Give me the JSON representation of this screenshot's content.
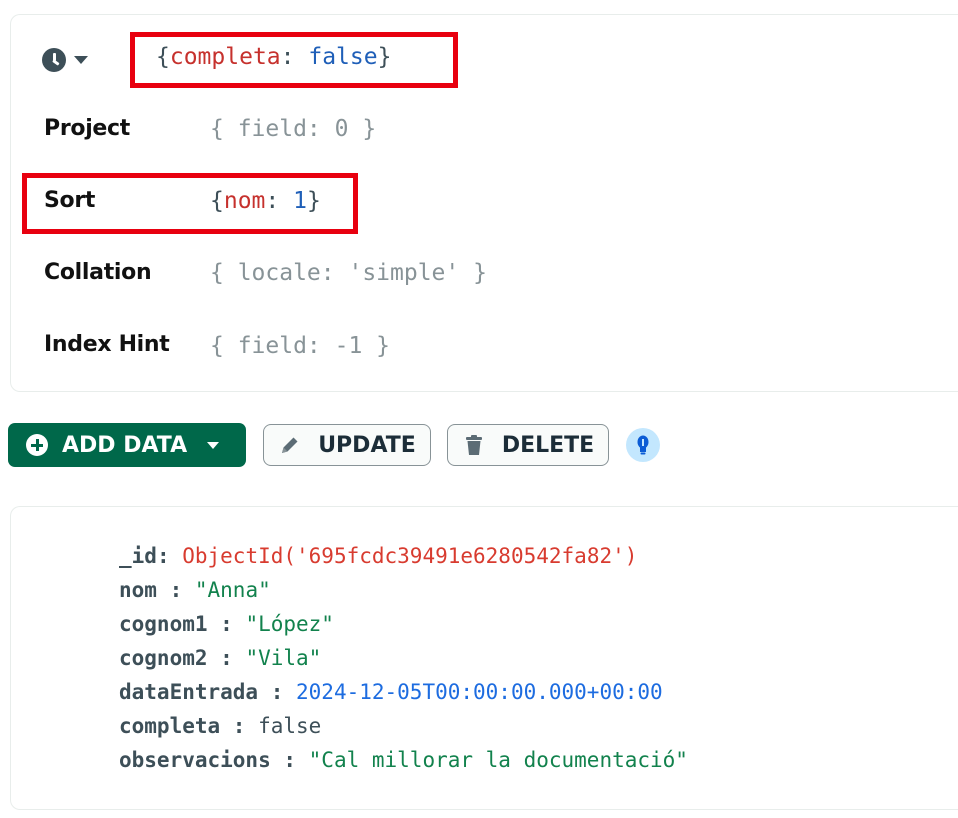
{
  "query": {
    "filter": {
      "key": "completa",
      "value": "false"
    },
    "project": {
      "label": "Project",
      "placeholder": "{ field: 0 }"
    },
    "sort": {
      "label": "Sort",
      "key": "nom",
      "value": "1"
    },
    "collation": {
      "label": "Collation",
      "placeholder": "{ locale: 'simple' }"
    },
    "hint": {
      "label": "Index Hint",
      "placeholder": "{ field: -1 }"
    }
  },
  "toolbar": {
    "add_data_label": "ADD DATA",
    "update_label": "UPDATE",
    "delete_label": "DELETE"
  },
  "document": {
    "fields": [
      {
        "key": "_id",
        "sep": ": ",
        "value": "ObjectId('695fcdc39491e6280542fa82')",
        "type": "objectid"
      },
      {
        "key": "nom",
        "sep": " : ",
        "value": "\"Anna\"",
        "type": "string"
      },
      {
        "key": "cognom1",
        "sep": " : ",
        "value": "\"López\"",
        "type": "string"
      },
      {
        "key": "cognom2",
        "sep": " : ",
        "value": "\"Vila\"",
        "type": "string"
      },
      {
        "key": "dataEntrada",
        "sep": " : ",
        "value": "2024-12-05T00:00:00.000+00:00",
        "type": "date"
      },
      {
        "key": "completa",
        "sep": " : ",
        "value": "false",
        "type": "boolean"
      },
      {
        "key": "observacions",
        "sep": " : ",
        "value": "\"Cal millorar la documentació\"",
        "type": "string"
      }
    ]
  },
  "colors": {
    "brand_green": "#00684a",
    "highlight_red": "#e8000f",
    "string_green": "#12824d",
    "objectid_red": "#d83b2f",
    "date_blue": "#1d6ce0"
  }
}
